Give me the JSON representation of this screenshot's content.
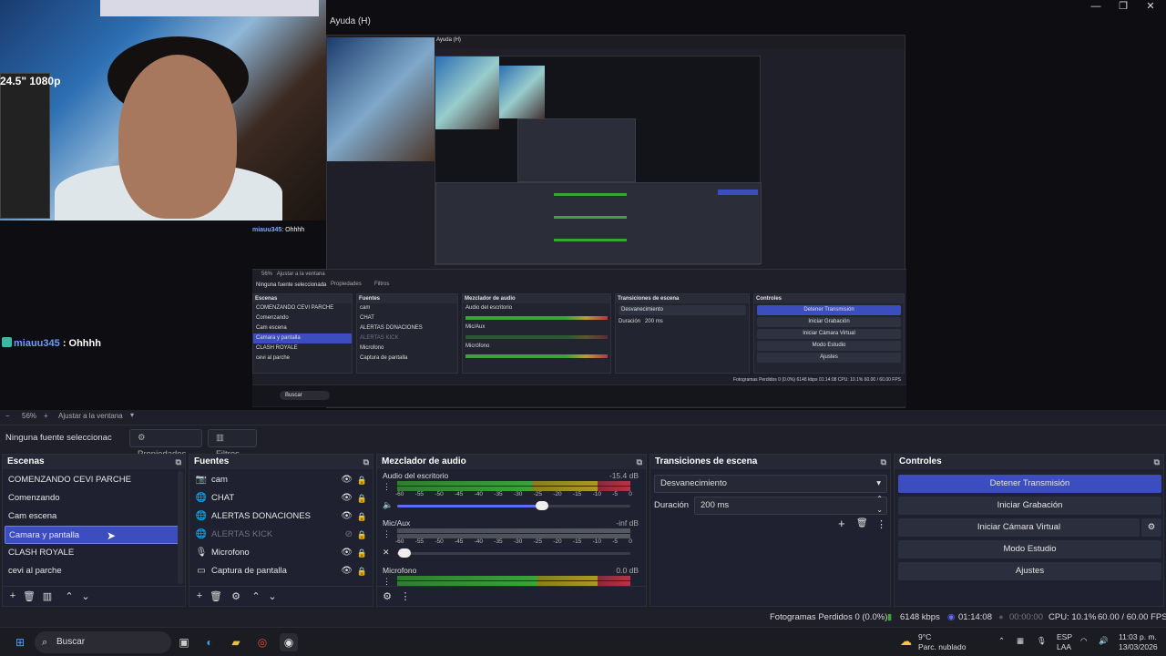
{
  "window": {
    "menu_help": "Ayuda (H)",
    "minimize": "—",
    "maximize": "❐",
    "close": "✕"
  },
  "preview": {
    "webcam_sign": "24.5\" 1080p",
    "chat": {
      "user": "miauu345",
      "message": ": Ohhhh"
    },
    "nested": {
      "menu_help": "Ayuda (H)",
      "chat_user": "miauu345",
      "chat_msg": ": Ohhhh",
      "zoom": "56%",
      "fit": "Ajustar a la ventana",
      "no_source": "Ninguna fuente seleccionada",
      "props": "Propiedades",
      "filters": "Filtros",
      "scenes_title": "Escenas",
      "scenes": [
        "COMENZANDO CEVI PARCHE",
        "Comenzando",
        "Cam escena",
        "Camara y pantalla",
        "CLASH ROYALE",
        "cevi al parche"
      ],
      "sources_title": "Fuentes",
      "sources": [
        "cam",
        "CHAT",
        "ALERTAS DONACIONES",
        "ALERTAS KICK",
        "Microfono",
        "Captura de pantalla"
      ],
      "mixer_title": "Mezclador de audio",
      "mixer": [
        "Audio del escritorio",
        "Mic/Aux",
        "Micrófono"
      ],
      "transitions_title": "Transiciones de escena",
      "transition": "Desvanecimiento",
      "duration_label": "Duración",
      "duration": "200 ms",
      "controls_title": "Controles",
      "controls": [
        "Detener Transmisión",
        "Iniciar Grabación",
        "Iniciar Cámara Virtual",
        "Modo Estudio",
        "Ajustes"
      ],
      "status": "Fotogramas Perdidos 0 (0.0%)   6148 kbps   01:14:08   CPU: 10.1%   60.00 / 60.00 FPS",
      "search": "Buscar"
    }
  },
  "zoombar": {
    "minus": "−",
    "zoom": "56%",
    "plus": "+",
    "fit": "Ajustar a la ventana"
  },
  "propbar": {
    "no_source": "Ninguna fuente seleccionac",
    "properties": "Propiedades",
    "filters": "Filtros"
  },
  "scenes": {
    "title": "Escenas",
    "items": [
      {
        "label": "COMENZANDO CEVI PARCHE",
        "selected": false
      },
      {
        "label": "Comenzando",
        "selected": false
      },
      {
        "label": "Cam escena",
        "selected": false
      },
      {
        "label": "Camara y pantalla",
        "selected": true
      },
      {
        "label": "CLASH ROYALE",
        "selected": false
      },
      {
        "label": "cevi al parche",
        "selected": false
      }
    ]
  },
  "sources": {
    "title": "Fuentes",
    "items": [
      {
        "label": "cam",
        "icon": "camera-icon",
        "visible": true
      },
      {
        "label": "CHAT",
        "icon": "globe-icon",
        "visible": true
      },
      {
        "label": "ALERTAS DONACIONES",
        "icon": "globe-icon",
        "visible": true
      },
      {
        "label": "ALERTAS KICK",
        "icon": "globe-icon",
        "visible": false
      },
      {
        "label": "Microfono",
        "icon": "microphone-icon",
        "visible": true
      },
      {
        "label": "Captura de pantalla",
        "icon": "monitor-icon",
        "visible": true
      }
    ]
  },
  "mixer": {
    "title": "Mezclador de audio",
    "ticks": [
      "-60",
      "-55",
      "-50",
      "-45",
      "-40",
      "-35",
      "-30",
      "-25",
      "-20",
      "-15",
      "-10",
      "-5",
      "0"
    ],
    "channels": [
      {
        "name": "Audio del escritorio",
        "db": "-15.4 dB",
        "volume": 0.62
      },
      {
        "name": "Mic/Aux",
        "db": "-inf dB",
        "volume": 0.03
      },
      {
        "name": "Microfono",
        "db": "0.0 dB",
        "volume": 0.8
      }
    ]
  },
  "transitions": {
    "title": "Transiciones de escena",
    "selected": "Desvanecimiento",
    "duration_label": "Duración",
    "duration": "200 ms"
  },
  "controls": {
    "title": "Controles",
    "stop_stream": "Detener Transmisión",
    "start_recording": "Iniciar Grabación",
    "start_virtual_cam": "Iniciar Cámara Virtual",
    "studio_mode": "Modo Estudio",
    "settings": "Ajustes"
  },
  "status": {
    "dropped": "Fotogramas Perdidos 0 (0.0%)",
    "bitrate": "6148 kbps",
    "stream_time": "01:14:08",
    "rec_time": "00:00:00",
    "cpu": "CPU: 10.1%",
    "fps": "60.00 / 60.00 FPS"
  },
  "taskbar": {
    "search": "Buscar",
    "weather_temp": "9°C",
    "weather_desc": "Parc. nublado",
    "lang1": "ESP",
    "lang2": "LAA",
    "time": "11:03 p. m.",
    "date": "13/03/2026"
  },
  "colors": {
    "accent": "#3b4dbf",
    "bg": "#1e1f29",
    "dock": "#1f2130"
  }
}
